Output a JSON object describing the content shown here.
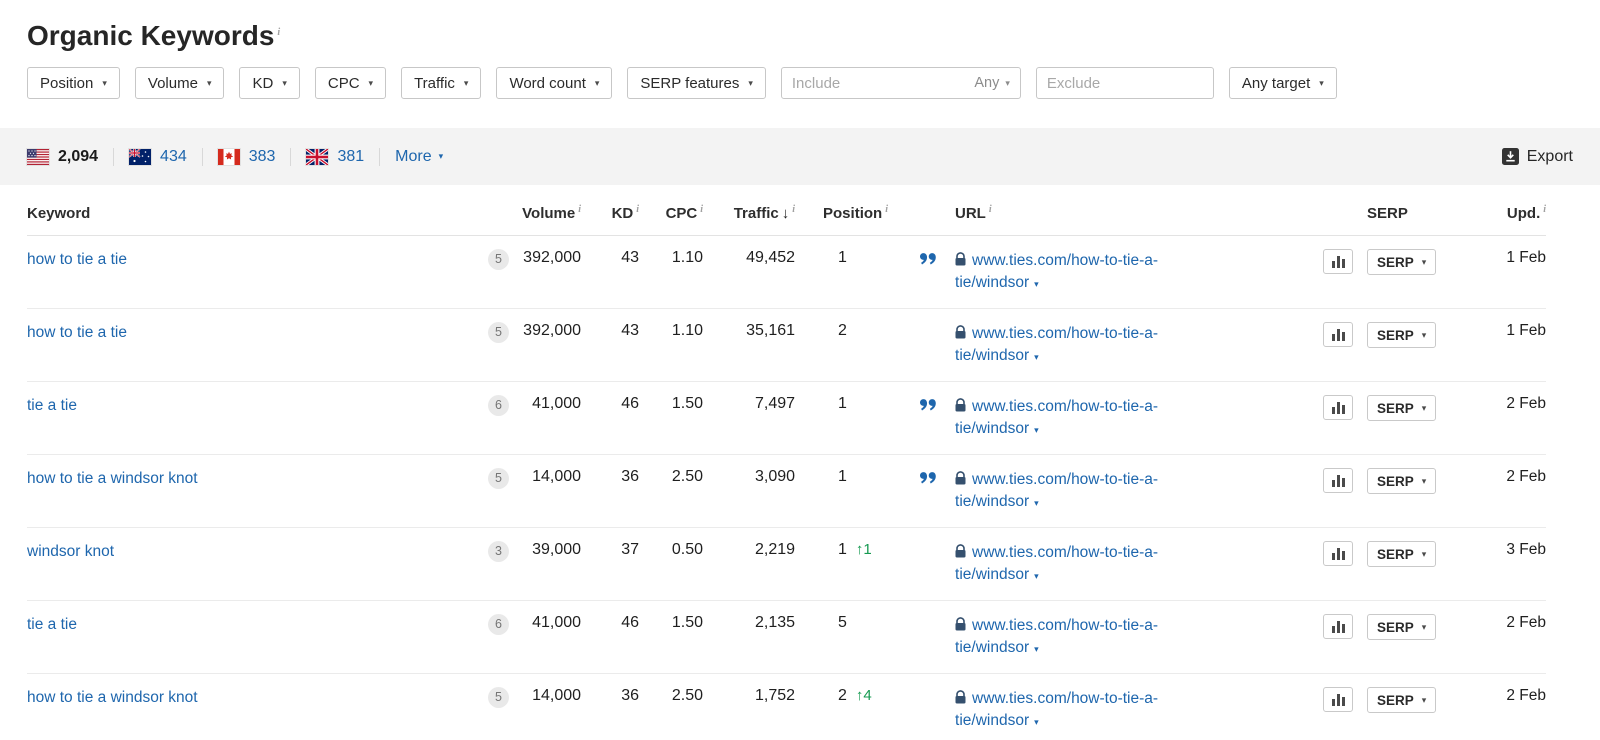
{
  "page": {
    "title": "Organic Keywords"
  },
  "icons": {
    "caret_down": "▾",
    "info": "i",
    "sort_desc": "↓",
    "up_arrow": "↑"
  },
  "colors": {
    "link_blue": "#1e66ad",
    "positive_green": "#169a51",
    "toolbar_gray": "#f3f3f3",
    "badge_gray": "#e9e9e9"
  },
  "filters": {
    "buttons": [
      "Position",
      "Volume",
      "KD",
      "CPC",
      "Traffic",
      "Word count",
      "SERP features"
    ],
    "include_placeholder": "Include",
    "include_mode": "Any",
    "exclude_placeholder": "Exclude",
    "target_label": "Any target"
  },
  "countries_bar": {
    "items": [
      {
        "country": "united-states",
        "count": "2,094",
        "selected": true
      },
      {
        "country": "australia",
        "count": "434",
        "selected": false
      },
      {
        "country": "canada",
        "count": "383",
        "selected": false
      },
      {
        "country": "united-kingdom",
        "count": "381",
        "selected": false
      }
    ],
    "more_label": "More",
    "export_label": "Export"
  },
  "table": {
    "headers": {
      "keyword": "Keyword",
      "volume": "Volume",
      "kd": "KD",
      "cpc": "CPC",
      "traffic": "Traffic",
      "position": "Position",
      "url": "URL",
      "serp": "SERP",
      "upd": "Upd."
    },
    "serp_button_label": "SERP",
    "rows": [
      {
        "keyword": "how to tie a tie",
        "badge": "5",
        "volume": "392,000",
        "kd": "43",
        "cpc": "1.10",
        "traffic": "49,452",
        "position": "1",
        "position_change": "",
        "snippet": true,
        "url": "www.ties.com/how-to-tie-a-tie/windsor",
        "updated": "1 Feb"
      },
      {
        "keyword": "how to tie a tie",
        "badge": "5",
        "volume": "392,000",
        "kd": "43",
        "cpc": "1.10",
        "traffic": "35,161",
        "position": "2",
        "position_change": "",
        "snippet": false,
        "url": "www.ties.com/how-to-tie-a-tie/windsor",
        "updated": "1 Feb"
      },
      {
        "keyword": "tie a tie",
        "badge": "6",
        "volume": "41,000",
        "kd": "46",
        "cpc": "1.50",
        "traffic": "7,497",
        "position": "1",
        "position_change": "",
        "snippet": true,
        "url": "www.ties.com/how-to-tie-a-tie/windsor",
        "updated": "2 Feb"
      },
      {
        "keyword": "how to tie a windsor knot",
        "badge": "5",
        "volume": "14,000",
        "kd": "36",
        "cpc": "2.50",
        "traffic": "3,090",
        "position": "1",
        "position_change": "",
        "snippet": true,
        "url": "www.ties.com/how-to-tie-a-tie/windsor",
        "updated": "2 Feb"
      },
      {
        "keyword": "windsor knot",
        "badge": "3",
        "volume": "39,000",
        "kd": "37",
        "cpc": "0.50",
        "traffic": "2,219",
        "position": "1",
        "position_change": "1",
        "snippet": false,
        "url": "www.ties.com/how-to-tie-a-tie/windsor",
        "updated": "3 Feb"
      },
      {
        "keyword": "tie a tie",
        "badge": "6",
        "volume": "41,000",
        "kd": "46",
        "cpc": "1.50",
        "traffic": "2,135",
        "position": "5",
        "position_change": "",
        "snippet": false,
        "url": "www.ties.com/how-to-tie-a-tie/windsor",
        "updated": "2 Feb"
      },
      {
        "keyword": "how to tie a windsor knot",
        "badge": "5",
        "volume": "14,000",
        "kd": "36",
        "cpc": "2.50",
        "traffic": "1,752",
        "position": "2",
        "position_change": "4",
        "snippet": false,
        "url": "www.ties.com/how-to-tie-a-tie/windsor",
        "updated": "2 Feb"
      }
    ]
  }
}
